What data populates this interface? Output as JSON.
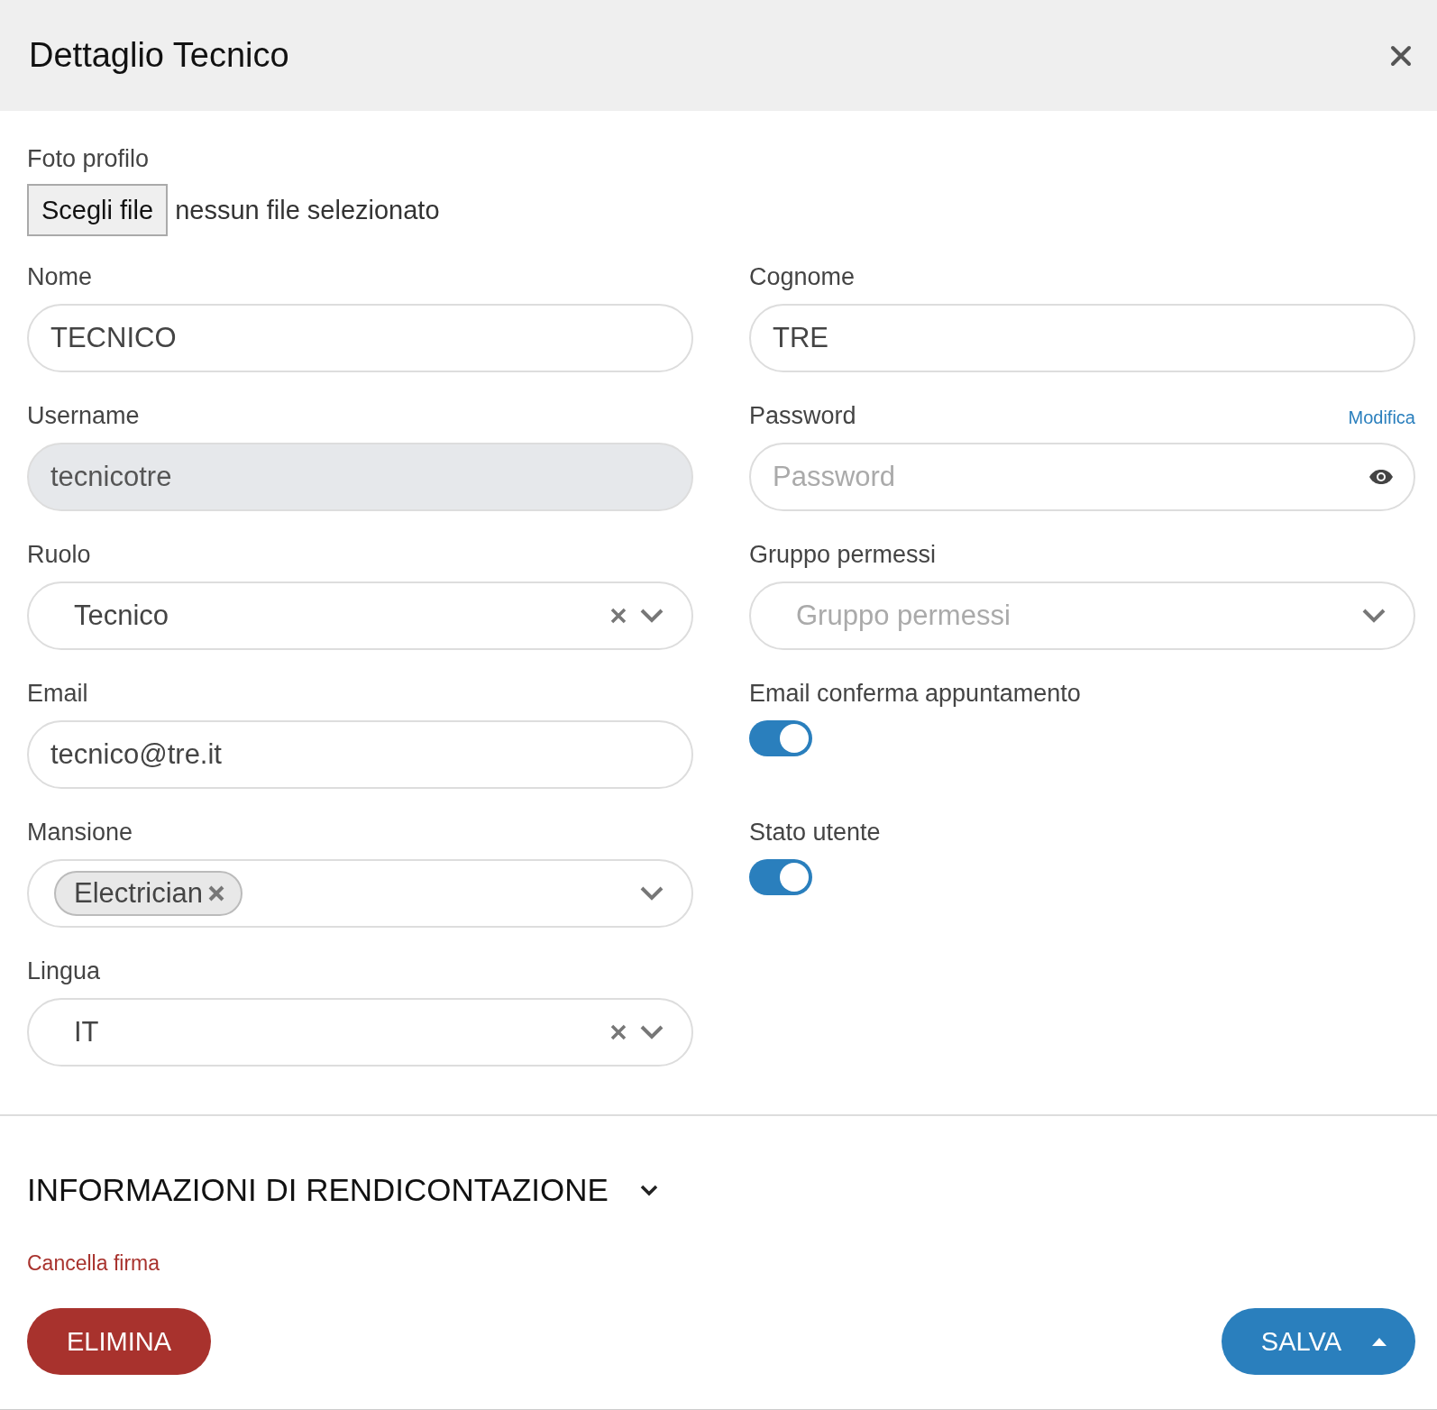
{
  "modal": {
    "title": "Dettaglio Tecnico"
  },
  "photo": {
    "label": "Foto profilo",
    "button": "Scegli file",
    "status": "nessun file selezionato"
  },
  "left": [
    {
      "kind": "text",
      "label": "Nome",
      "value": "TECNICO",
      "disabled": false
    },
    {
      "kind": "text",
      "label": "Username",
      "value": "tecnicotre",
      "disabled": true
    },
    {
      "kind": "select",
      "label": "Ruolo",
      "value": "Tecnico",
      "clearable": true
    },
    {
      "kind": "text",
      "label": "Email",
      "value": "tecnico@tre.it",
      "disabled": false
    },
    {
      "kind": "tags",
      "label": "Mansione",
      "tags": [
        "Electrician"
      ]
    },
    {
      "kind": "select",
      "label": "Lingua",
      "value": "IT",
      "clearable": true
    }
  ],
  "right": [
    {
      "kind": "text",
      "label": "Cognome",
      "value": "TRE",
      "disabled": false
    },
    {
      "kind": "password",
      "label": "Password",
      "link": "Modifica",
      "placeholder": "Password"
    },
    {
      "kind": "select",
      "label": "Gruppo permessi",
      "placeholder": "Gruppo permessi",
      "clearable": false
    },
    {
      "kind": "toggle",
      "label": "Email conferma appuntamento",
      "on": true
    },
    {
      "kind": "toggle",
      "label": "Stato utente",
      "on": true
    }
  ],
  "section": {
    "title": "INFORMAZIONI DI RENDICONTAZIONE",
    "expanded": false
  },
  "clear_signature": "Cancella firma",
  "buttons": {
    "delete": "ELIMINA",
    "save": "SALVA"
  }
}
